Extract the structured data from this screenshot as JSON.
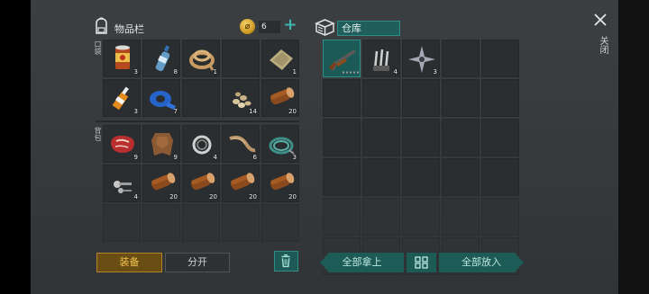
{
  "header": {
    "inventory_title": "物品栏",
    "coins": "6",
    "warehouse_title": "仓库",
    "close_label": "关闭"
  },
  "sections": {
    "pocket_label": "口袋",
    "backpack_label": "背包"
  },
  "pocket": [
    {
      "item": "canned-food-icon",
      "count": "3"
    },
    {
      "item": "water-bottle-icon",
      "count": "8"
    },
    {
      "item": "rope-coil-icon",
      "count": "1"
    },
    {
      "item": "",
      "count": ""
    },
    {
      "item": "cloth-icon",
      "count": "1"
    },
    {
      "item": "glue-tube-icon",
      "count": "3"
    },
    {
      "item": "duct-tape-icon",
      "count": "7"
    },
    {
      "item": "",
      "count": ""
    },
    {
      "item": "seeds-icon",
      "count": "14"
    },
    {
      "item": "wood-log-icon",
      "count": "20"
    }
  ],
  "backpack": [
    {
      "item": "raw-meat-icon",
      "count": "9"
    },
    {
      "item": "animal-hide-icon",
      "count": "9"
    },
    {
      "item": "chain-ring-icon",
      "count": "4"
    },
    {
      "item": "rope-icon",
      "count": "6"
    },
    {
      "item": "wire-coil-icon",
      "count": "3"
    },
    {
      "item": "nails-icon",
      "count": "4"
    },
    {
      "item": "wood-log-icon",
      "count": "20"
    },
    {
      "item": "wood-log-icon",
      "count": "20"
    },
    {
      "item": "wood-log-icon",
      "count": "20"
    },
    {
      "item": "wood-log-icon",
      "count": "20"
    }
  ],
  "warehouse": [
    {
      "item": "shotgun-icon",
      "count": "",
      "selected": true,
      "durability": true
    },
    {
      "item": "claw-blades-icon",
      "count": "4"
    },
    {
      "item": "shuriken-icon",
      "count": "3"
    }
  ],
  "buttons": {
    "equip": "装备",
    "split": "分开",
    "take_all": "全部拿上",
    "put_all": "全部放入"
  },
  "colors": {
    "accent_teal": "#1d5b57",
    "equip_gold": "#f2c44e",
    "panel": "#393d3f"
  }
}
